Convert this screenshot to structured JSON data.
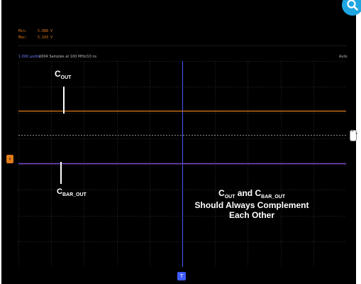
{
  "measurements": {
    "min_label": "Min:",
    "min_value": "5.088 V",
    "max_label": "Max:",
    "max_value": "5.103 V"
  },
  "status_bar": {
    "timebase": "1.000 µs/div",
    "sample_info": "1604 Samples at 100 MHz/10 ns",
    "trigger_mode": "Auto"
  },
  "annotations": {
    "cout_main": "C",
    "cout_sub": "OUT",
    "cbar_main": "C",
    "cbar_sub": "BAR_OUT",
    "note_line1_a": "C",
    "note_line1_a_sub": "OUT",
    "note_line1_b": " and C",
    "note_line1_b_sub": "BAR_OUT",
    "note_line2": "Should Always Complement",
    "note_line3": "Each Other"
  },
  "markers": {
    "channel_marker": "›",
    "trigger_level_marker": "⌃⌄",
    "trigger_position_marker": "T"
  },
  "traces": {
    "cout": {
      "color": "#e07a1a",
      "level_fraction": 0.24
    },
    "cbar_out": {
      "color": "#7a46c8",
      "level_fraction": 0.495
    }
  },
  "colors": {
    "background": "#000000",
    "grid": "#2a2a2a",
    "center_line": "#8a8a8a",
    "trigger_line": "#3f5bff",
    "accent_orange": "#e07a1a",
    "zoom_button": "#1fa6e0"
  },
  "icons": {
    "zoom": "magnifier-icon"
  }
}
